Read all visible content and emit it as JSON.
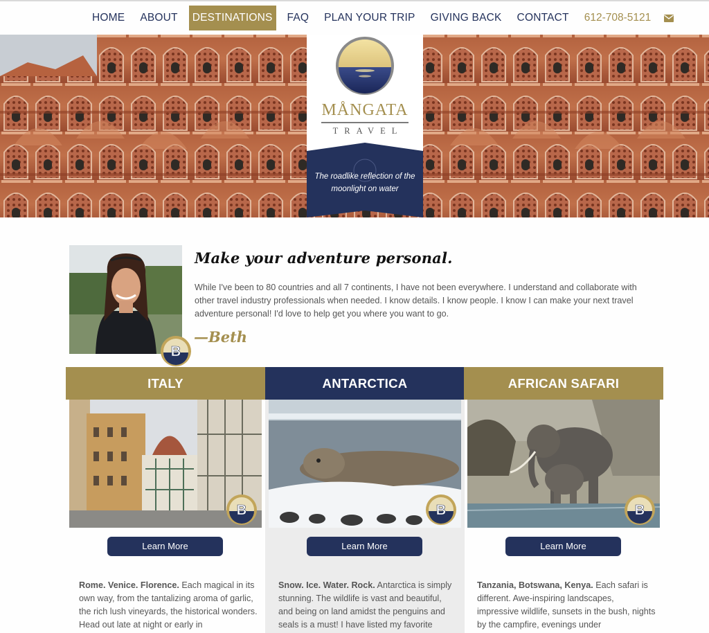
{
  "nav": {
    "items": [
      {
        "label": "HOME",
        "active": false
      },
      {
        "label": "ABOUT",
        "active": false
      },
      {
        "label": "DESTINATIONS",
        "active": true
      },
      {
        "label": "FAQ",
        "active": false
      },
      {
        "label": "PLAN YOUR TRIP",
        "active": false
      },
      {
        "label": "GIVING BACK",
        "active": false
      },
      {
        "label": "CONTACT",
        "active": false
      }
    ],
    "phone": "612-708-5121",
    "mail_icon": "envelope-icon"
  },
  "logo": {
    "name": "MÅNGATA",
    "sub": "TRAVEL",
    "tagline": "The roadlike reflection of the moonlight on water"
  },
  "intro": {
    "title": "Make your adventure personal.",
    "text": "While I've been to 80 countries and all 7 continents, I have not been everywhere. I understand and collaborate with other travel industry professionals when needed. I know details. I know people. I know I can make your next travel adventure personal! I'd love to help get you where you want to go.",
    "signature": "—Beth",
    "badge_letter": "B"
  },
  "cards": [
    {
      "title": "ITALY",
      "button": "Learn More",
      "lead": "Rome. Venice. Florence.",
      "text": " Each magical in its own way, from the tantalizing aroma of garlic, the rich lush vineyards, the historical wonders. Head out late at night or early in",
      "badge_letter": "B"
    },
    {
      "title": "ANTARCTICA",
      "button": "Learn More",
      "lead": "Snow. Ice. Water. Rock.",
      "text": " Antarctica is simply stunning. The wildlife is vast and beautiful, and being on land amidst the penguins and seals is a must! I have listed my favorite",
      "badge_letter": "B"
    },
    {
      "title": "AFRICAN SAFARI",
      "button": "Learn More",
      "lead": "Tanzania, Botswana, Kenya.",
      "text": " Each safari is different. Awe-inspiring landscapes, impressive wildlife, sunsets in the bush, nights by the campfire, evenings under",
      "badge_letter": "B"
    }
  ],
  "colors": {
    "navy": "#24325c",
    "gold": "#a48f4f",
    "text": "#555555"
  }
}
